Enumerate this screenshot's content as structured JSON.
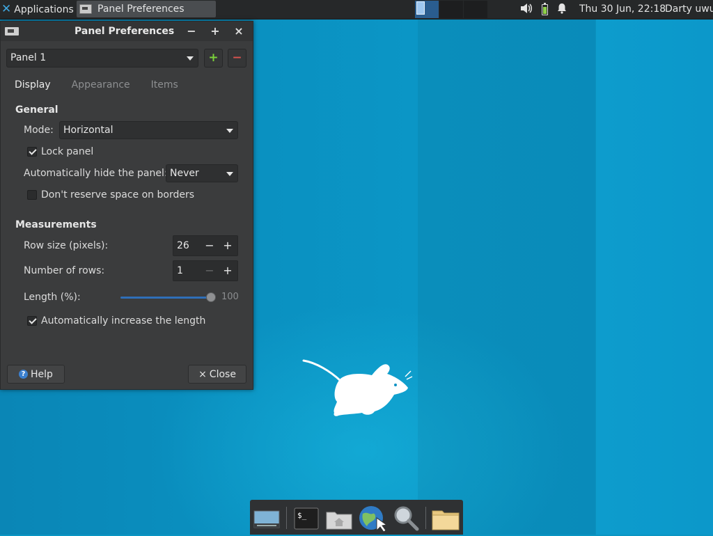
{
  "top_panel": {
    "apps_label": "Applications",
    "apps_sep_glyph": "⋮",
    "task_title": "Panel Preferences",
    "clock": "Thu 30 Jun, 22:18",
    "user": "Darty uwu",
    "icons": [
      "xfce-logo-icon",
      "window-icon",
      "volume-icon",
      "battery-icon",
      "notification-bell-icon"
    ],
    "active_workspace_color": "#2a5d8f"
  },
  "dialog": {
    "title": "Panel Preferences",
    "minimize": "−",
    "maximize": "+",
    "close": "×",
    "panel_selected": "Panel 1",
    "add_panel": "+",
    "remove_panel": "−",
    "tabs": [
      {
        "label": "Display",
        "active": true
      },
      {
        "label": "Appearance",
        "active": false
      },
      {
        "label": "Items",
        "active": false
      }
    ],
    "general": {
      "title": "General",
      "mode_label": "Mode:",
      "mode_value": "Horizontal",
      "lock_panel": "Lock panel",
      "lock_panel_checked": true,
      "autohide_label": "Automatically hide the panel:",
      "autohide_value": "Never",
      "reserve_space": "Don't reserve space on borders",
      "reserve_space_checked": false
    },
    "measurements": {
      "title": "Measurements",
      "row_size_label": "Row size (pixels):",
      "row_size_value": "26",
      "rows_label": "Number of rows:",
      "rows_value": "1",
      "length_label": "Length (%):",
      "length_value": "100",
      "length_percent": 100,
      "auto_length": "Automatically increase the length",
      "auto_length_checked": true
    },
    "help_button": "Help",
    "close_button": "Close",
    "close_glyph": "×"
  },
  "dock": {
    "items": [
      "show-desktop-icon",
      "terminal-icon",
      "home-folder-icon",
      "web-browser-icon",
      "app-finder-icon",
      "file-manager-icon"
    ],
    "terminal_text": "$_"
  },
  "colors": {
    "desktop": "#0a95c3",
    "panel": "#262829",
    "dialog": "#3b3c3d",
    "add_green": "#7bd33b",
    "remove_red": "#d9534f",
    "slider_blue": "#2f6fb8"
  }
}
